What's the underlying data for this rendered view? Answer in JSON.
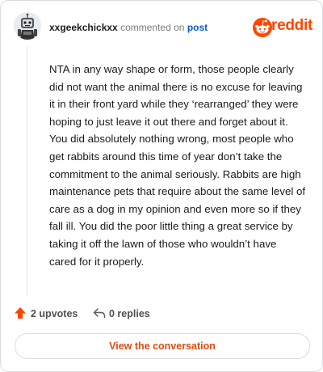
{
  "header": {
    "username": "xxgeekchickxx",
    "action_text": "commented on",
    "post_link_label": "post",
    "brand_label": "reddit"
  },
  "comment": {
    "body": "NTA in any way shape or form, those people clearly did not want the animal there is no excuse for leaving it in their front yard while they ‘rearranged’ they were hoping to just leave it out there and forget about it. You did absolutely nothing wrong, most people who get rabbits around this time of year don’t take the commitment to the animal seriously. Rabbits are high maintenance pets that require about the same level of care as a dog in my opinion and even more so if they fall ill. You did the poor little thing a great service by taking it off the lawn of those who wouldn’t have cared for it properly."
  },
  "actions": {
    "upvotes_label": "2 upvotes",
    "replies_label": "0 replies"
  },
  "cta": {
    "label": "View the conversation"
  },
  "colors": {
    "brand": "#ff4500",
    "link": "#0a58ca",
    "cta_text": "#e24a10"
  },
  "icons": {
    "avatar": "robot-avatar-icon",
    "brand": "reddit-alien-icon",
    "upvote": "upvote-arrow-icon",
    "reply": "reply-arrow-icon"
  }
}
